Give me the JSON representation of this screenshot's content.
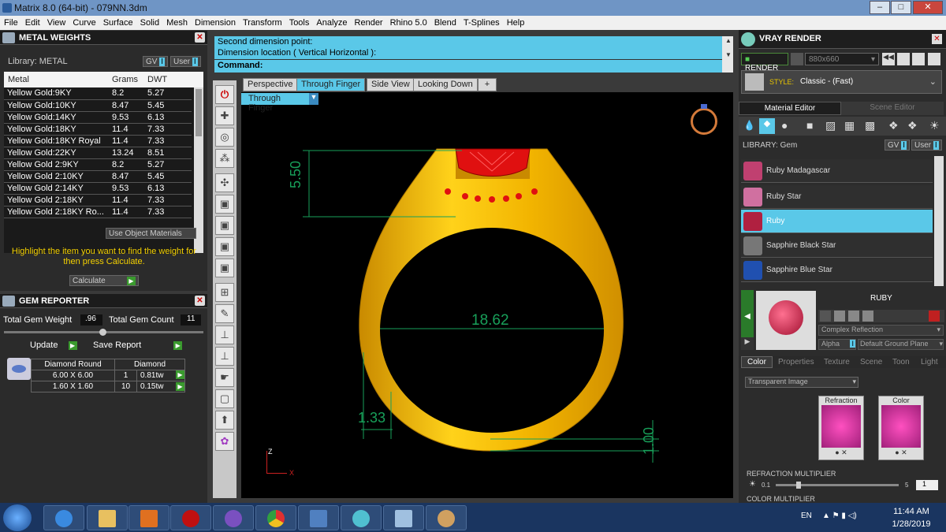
{
  "title": "Matrix 8.0 (64-bit) - 079NN.3dm",
  "menu": [
    "File",
    "Edit",
    "View",
    "Curve",
    "Surface",
    "Solid",
    "Mesh",
    "Dimension",
    "Transform",
    "Tools",
    "Analyze",
    "Render",
    "Rhino 5.0",
    "Blend",
    "T-Splines",
    "Help"
  ],
  "metal": {
    "title": "METAL WEIGHTS",
    "library": "Library: METAL",
    "gv": "GV",
    "user": "User",
    "columns": [
      "Metal",
      "Grams",
      "DWT"
    ],
    "rows": [
      [
        "Yellow Gold:9KY",
        "8.2",
        "5.27"
      ],
      [
        "Yellow Gold:10KY",
        "8.47",
        "5.45"
      ],
      [
        "Yellow Gold:14KY",
        "9.53",
        "6.13"
      ],
      [
        "Yellow Gold:18KY",
        "11.4",
        "7.33"
      ],
      [
        "Yellow Gold:18KY Royal",
        "11.4",
        "7.33"
      ],
      [
        "Yellow Gold:22KY",
        "13.24",
        "8.51"
      ],
      [
        "Yellow Gold 2:9KY",
        "8.2",
        "5.27"
      ],
      [
        "Yellow Gold 2:10KY",
        "8.47",
        "5.45"
      ],
      [
        "Yellow Gold 2:14KY",
        "9.53",
        "6.13"
      ],
      [
        "Yellow Gold 2:18KY",
        "11.4",
        "7.33"
      ],
      [
        "Yellow Gold 2:18KY Ro...",
        "11.4",
        "7.33"
      ]
    ],
    "use_obj": "Use Object Materials",
    "hint": "Highlight the item you want to find the weight for then press Calculate.",
    "calculate": "Calculate"
  },
  "gem": {
    "title": "GEM REPORTER",
    "total_weight_label": "Total Gem Weight",
    "total_weight": ".96",
    "total_count_label": "Total Gem Count",
    "total_count": "11",
    "update": "Update",
    "save": "Save Report",
    "head1": "Diamond Round",
    "head2": "Diamond",
    "rows": [
      [
        "6.00 X 6.00",
        "1",
        "0.81tw"
      ],
      [
        "1.60 X 1.60",
        "10",
        "0.15tw"
      ]
    ]
  },
  "command": {
    "line1": "Second dimension point:",
    "line2": "Dimension location ( Vertical  Horizontal ):",
    "line3": "Command:"
  },
  "tabs": [
    "Perspective",
    "Through Finger",
    "Side View",
    "Looking Down",
    "+"
  ],
  "viewport_label": "Through Finger",
  "dims": {
    "d1": "5.50",
    "d2": "18.62",
    "d3": "1.33",
    "d4": "1.00"
  },
  "axis": {
    "z": "Z",
    "x": "X"
  },
  "vray": {
    "title": "VRAY RENDER",
    "render": "RENDER",
    "size": "880x660",
    "style_label": "STYLE:",
    "style": "Classic - (Fast)",
    "tab1": "Material Editor",
    "tab2": "Scene Editor",
    "library": "LIBRARY: Gem",
    "gv": "GV",
    "user": "User",
    "items": [
      "Ruby Madagascar",
      "Ruby Star",
      "Ruby",
      "Sapphire Black Star",
      "Sapphire Blue Star"
    ],
    "selected": "RUBY",
    "reflection": "Complex Reflection",
    "alpha": "Alpha",
    "ground": "Default Ground Plane",
    "subtabs": [
      "Color",
      "Properties",
      "Texture",
      "Scene",
      "Toon",
      "Light"
    ],
    "transparent": "Transparent Image",
    "refraction": "Refraction",
    "color": "Color",
    "refr_mult": "REFRACTION MULTIPLIER",
    "refr_min": "0.1",
    "refr_max": "5",
    "refr_val": "1",
    "color_mult": "COLOR MULTIPLIER"
  },
  "tray": {
    "lang": "EN",
    "time": "11:44 AM",
    "date": "1/28/2019"
  },
  "colors": {
    "gold": "#f2b400",
    "ruby": "#e01010",
    "dim": "#18a05a",
    "cyan": "#5ac8e8"
  }
}
